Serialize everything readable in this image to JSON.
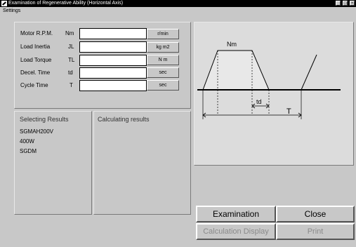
{
  "window": {
    "title": "Examination of Regenerative Ability (Horizontal Axis)",
    "controls": [
      "_",
      "□",
      "×"
    ]
  },
  "menubar": {
    "items": [
      "Settings"
    ]
  },
  "inputs": [
    {
      "label": "Motor R.P.M.",
      "symbol": "Nm",
      "value": "",
      "unit": "r/min"
    },
    {
      "label": "Load Inertia",
      "symbol": "JL",
      "value": "",
      "unit": "kg m2"
    },
    {
      "label": "Load Torque",
      "symbol": "TL",
      "value": "",
      "unit": "N m"
    },
    {
      "label": "Decel. Time",
      "symbol": "td",
      "value": "",
      "unit": "sec"
    },
    {
      "label": "Cycle Time",
      "symbol": "T",
      "value": "",
      "unit": "sec"
    }
  ],
  "selecting_results": {
    "title": "Selecting Results",
    "lines": [
      "SGMAH200V",
      "400W",
      "SGDM"
    ]
  },
  "calculating_results": {
    "title": "Calculating results"
  },
  "diagram": {
    "nm_label": "Nm",
    "td_label": "td",
    "t_label": "T"
  },
  "buttons": {
    "examination": "Examination",
    "close": "Close",
    "calculation_display": "Calculation Display",
    "print": "Print"
  }
}
